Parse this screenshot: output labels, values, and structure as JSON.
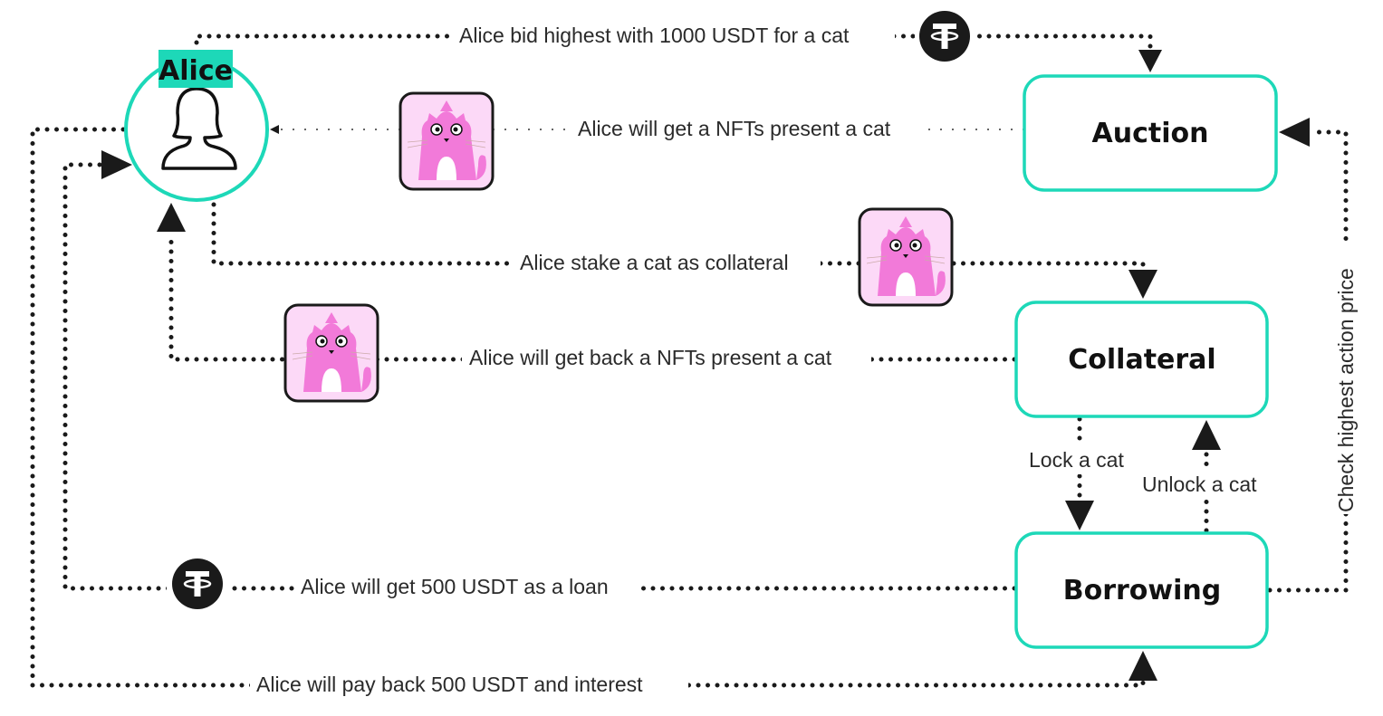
{
  "colors": {
    "accent": "#1dd8b8",
    "line": "#1a1a1a",
    "nft_bg": "#fcd9f7",
    "cat_pink": "#f27ad9"
  },
  "actor": {
    "name": "Alice",
    "icon": "user-female-icon"
  },
  "nodes": {
    "auction": "Auction",
    "collateral": "Collateral",
    "borrowing": "Borrowing"
  },
  "edges": {
    "bid": "Alice bid highest with 1000 USDT for a cat",
    "get_nft": "Alice will get a NFTs present a cat",
    "stake": "Alice stake a cat as collateral",
    "get_back": "Alice will get back a NFTs present a cat",
    "lock": "Lock a cat",
    "unlock": "Unlock a cat",
    "check_price": "Check highest action price",
    "loan": "Alice will get 500 USDT as a loan",
    "pay_back": "Alice will pay back 500 USDT and interest"
  },
  "icons": {
    "token": "tether-usdt-icon",
    "nft": "cat-nft-icon"
  }
}
